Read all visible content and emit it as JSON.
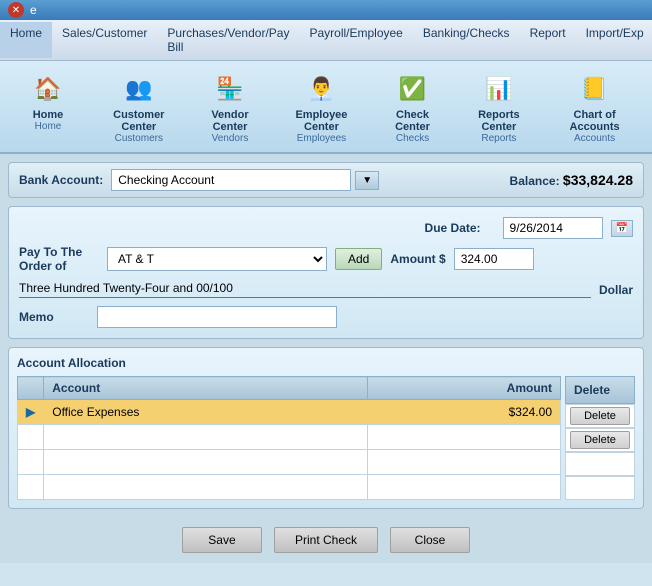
{
  "titleBar": {
    "title": "e"
  },
  "menuBar": {
    "items": [
      {
        "label": "Home"
      },
      {
        "label": "Sales/Customer"
      },
      {
        "label": "Purchases/Vendor/Pay Bill"
      },
      {
        "label": "Payroll/Employee"
      },
      {
        "label": "Banking/Checks"
      },
      {
        "label": "Report"
      },
      {
        "label": "Import/Exp"
      }
    ]
  },
  "toolbar": {
    "items": [
      {
        "icon": "🏠",
        "label": "Home",
        "sub": "Home"
      },
      {
        "icon": "👥",
        "label": "Customer Center",
        "sub": "Customers"
      },
      {
        "icon": "🏪",
        "label": "Vendor Center",
        "sub": "Vendors"
      },
      {
        "icon": "👨‍💼",
        "label": "Employee Center",
        "sub": "Employees"
      },
      {
        "icon": "✅",
        "label": "Check Center",
        "sub": "Checks"
      },
      {
        "icon": "📊",
        "label": "Reports Center",
        "sub": "Reports"
      },
      {
        "icon": "📒",
        "label": "Chart of Accounts",
        "sub": "Accounts"
      }
    ]
  },
  "bankSection": {
    "label": "Bank Account:",
    "value": "Checking Account",
    "balanceLabel": "Balance:",
    "balanceValue": "$33,824.28"
  },
  "checkForm": {
    "dueDateLabel": "Due Date:",
    "dueDate": "9/26/2014",
    "payToLabel": "Pay To The\nOrder of",
    "payToValue": "AT & T",
    "addLabel": "Add",
    "amountLabel": "Amount $",
    "amountValue": "324.00",
    "writtenAmount": "Three Hundred Twenty-Four and 00/100",
    "dollarLabel": "Dollar",
    "memoLabel": "Memo"
  },
  "allocationSection": {
    "title": "Account Allocation",
    "columns": {
      "account": "Account",
      "amount": "Amount",
      "delete": "Delete"
    },
    "rows": [
      {
        "indicator": "▶",
        "account": "Office Expenses",
        "amount": "$324.00",
        "selected": true
      },
      {
        "indicator": "",
        "account": "",
        "amount": "",
        "selected": false
      },
      {
        "indicator": "",
        "account": "",
        "amount": "",
        "selected": false
      },
      {
        "indicator": "",
        "account": "",
        "amount": "",
        "selected": false
      }
    ],
    "deleteButtons": [
      "Delete",
      "Delete",
      "",
      ""
    ]
  },
  "buttons": {
    "save": "Save",
    "printCheck": "Print Check",
    "close": "Close"
  }
}
